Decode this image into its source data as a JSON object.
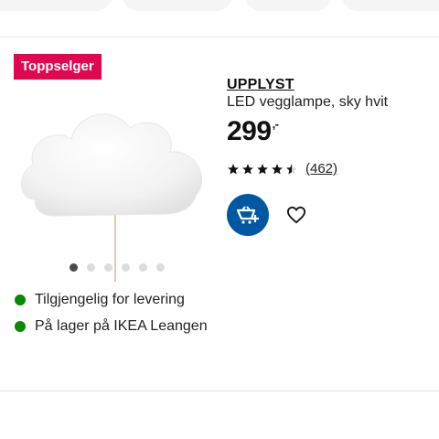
{
  "product": {
    "badge": "Toppselger",
    "name": "UPPLYST",
    "description": "LED vegglampe, sky hvit",
    "price": "299",
    "price_suffix": ",-",
    "rating": 4.5,
    "rating_max": 5,
    "review_count": "(462)",
    "image_count": 6,
    "active_image": 1
  },
  "availability": [
    {
      "text": "Tilgjengelig for levering",
      "color": "#0a8a00"
    },
    {
      "text": "På lager på IKEA Leangen",
      "color": "#0a8a00"
    }
  ],
  "icons": {
    "cart": "add-to-cart-icon",
    "favorite": "heart-icon"
  },
  "colors": {
    "badge": "#e00751",
    "cart_button": "#0058a3",
    "in_stock": "#0a8a00"
  }
}
